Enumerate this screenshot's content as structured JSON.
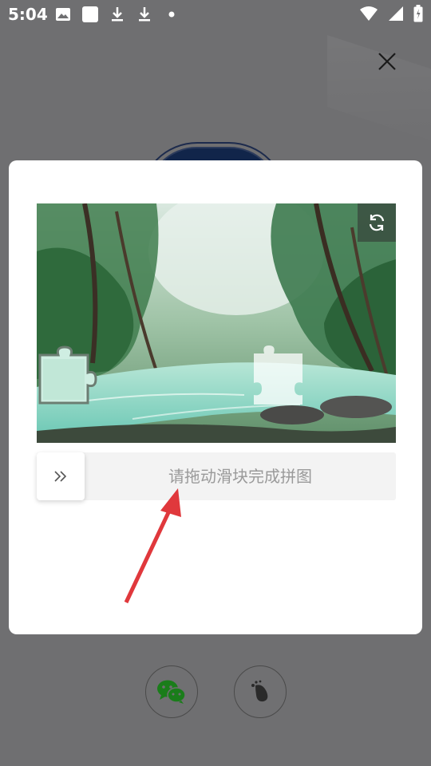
{
  "status_bar": {
    "time": "5:04",
    "left_icons": [
      "image-icon",
      "square-icon",
      "download-icon",
      "download-icon",
      "dot-icon"
    ],
    "right_icons": [
      "wifi-icon",
      "signal-icon",
      "battery-icon"
    ]
  },
  "close": {
    "icon": "close-icon"
  },
  "captcha": {
    "refresh_icon": "refresh-icon",
    "slider_hint": "请拖动滑块完成拼图",
    "handle_icon": "double-chevron-right-icon"
  },
  "bottom_login": {
    "icons": [
      "wechat-icon",
      "footprint-icon"
    ]
  },
  "colors": {
    "overlay": "#6f6f71",
    "arrow": "#e0383c",
    "track": "#f3f3f3"
  }
}
